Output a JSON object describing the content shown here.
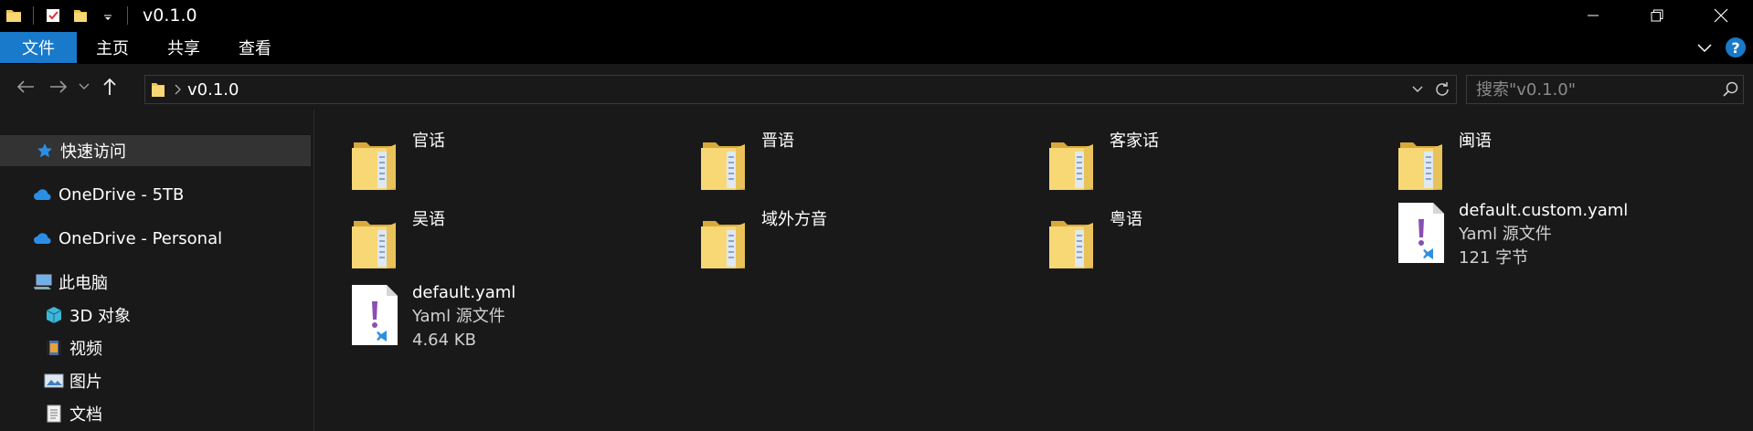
{
  "window": {
    "title": "v0.1.0",
    "accent": "#1979ca"
  },
  "ribbon": {
    "tabs": [
      {
        "label": "文件",
        "active": true
      },
      {
        "label": "主页"
      },
      {
        "label": "共享"
      },
      {
        "label": "查看"
      }
    ],
    "help_label": "?"
  },
  "address": {
    "path": [
      "v0.1.0"
    ],
    "search_placeholder": "搜索\"v0.1.0\""
  },
  "sidebar": {
    "items": [
      {
        "label": "快速访问",
        "icon": "star-icon"
      },
      {
        "label": "OneDrive - 5TB",
        "icon": "cloud-icon"
      },
      {
        "label": "OneDrive - Personal",
        "icon": "cloud-icon"
      },
      {
        "label": "此电脑",
        "icon": "computer-icon"
      },
      {
        "label": "3D 对象",
        "icon": "cube-icon"
      },
      {
        "label": "视频",
        "icon": "video-icon"
      },
      {
        "label": "图片",
        "icon": "picture-icon"
      },
      {
        "label": "文档",
        "icon": "document-icon"
      }
    ]
  },
  "files": [
    {
      "name": "官话",
      "type": "folder"
    },
    {
      "name": "晋语",
      "type": "folder"
    },
    {
      "name": "客家话",
      "type": "folder"
    },
    {
      "name": "闽语",
      "type": "folder"
    },
    {
      "name": "吴语",
      "type": "folder"
    },
    {
      "name": "域外方音",
      "type": "folder"
    },
    {
      "name": "粤语",
      "type": "folder"
    },
    {
      "name": "default.custom.yaml",
      "type": "yaml",
      "kind": "Yaml 源文件",
      "size": "121 字节"
    },
    {
      "name": "default.yaml",
      "type": "yaml",
      "kind": "Yaml 源文件",
      "size": "4.64 KB"
    }
  ]
}
